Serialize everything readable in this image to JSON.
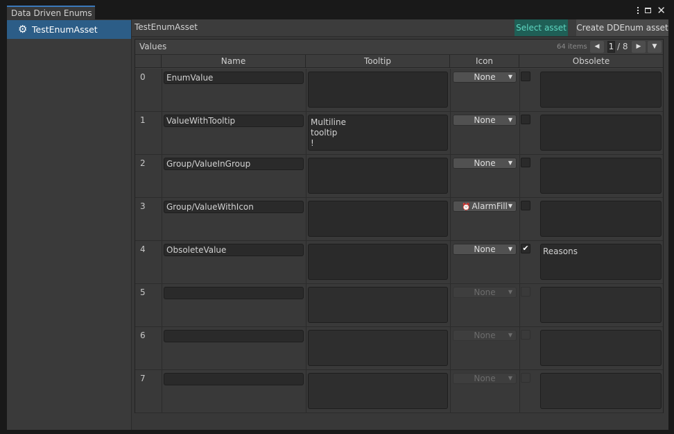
{
  "window": {
    "tab_title": "Data Driven Enums"
  },
  "sidebar": {
    "items": [
      {
        "label": "TestEnumAsset",
        "icon": "gear-icon",
        "selected": true
      }
    ]
  },
  "toolbar": {
    "asset_name": "TestEnumAsset",
    "select_asset_label": "Select asset",
    "create_label": "Create DDEnum asset"
  },
  "list": {
    "title": "Values",
    "count_label": "64 items",
    "page_current": "1",
    "page_total": "/ 8",
    "columns": [
      "Name",
      "Tooltip",
      "Icon",
      "Obsolete"
    ],
    "rows": [
      {
        "index": "0",
        "name": "EnumValue",
        "tooltip": "",
        "icon": "None",
        "obsolete": false,
        "reason": ""
      },
      {
        "index": "1",
        "name": "ValueWithTooltip",
        "tooltip": "Multiline\ntooltip\n!",
        "icon": "None",
        "obsolete": false,
        "reason": ""
      },
      {
        "index": "2",
        "name": "Group/ValueInGroup",
        "tooltip": "",
        "icon": "None",
        "obsolete": false,
        "reason": ""
      },
      {
        "index": "3",
        "name": "Group/ValueWithIcon",
        "tooltip": "",
        "icon": "AlarmFill",
        "obsolete": false,
        "reason": ""
      },
      {
        "index": "4",
        "name": "ObsoleteValue",
        "tooltip": "",
        "icon": "None",
        "obsolete": true,
        "reason": "Reasons"
      },
      {
        "index": "5",
        "name": "",
        "tooltip": "",
        "icon": "None",
        "obsolete": false,
        "reason": ""
      },
      {
        "index": "6",
        "name": "",
        "tooltip": "",
        "icon": "None",
        "obsolete": false,
        "reason": ""
      },
      {
        "index": "7",
        "name": "",
        "tooltip": "",
        "icon": "None",
        "obsolete": false,
        "reason": ""
      }
    ]
  },
  "colors": {
    "tab_accent": "#3a79bb",
    "selection": "#2c5d87",
    "select_button_bg": "#1f5f56",
    "select_button_text": "#5fd8c2"
  }
}
